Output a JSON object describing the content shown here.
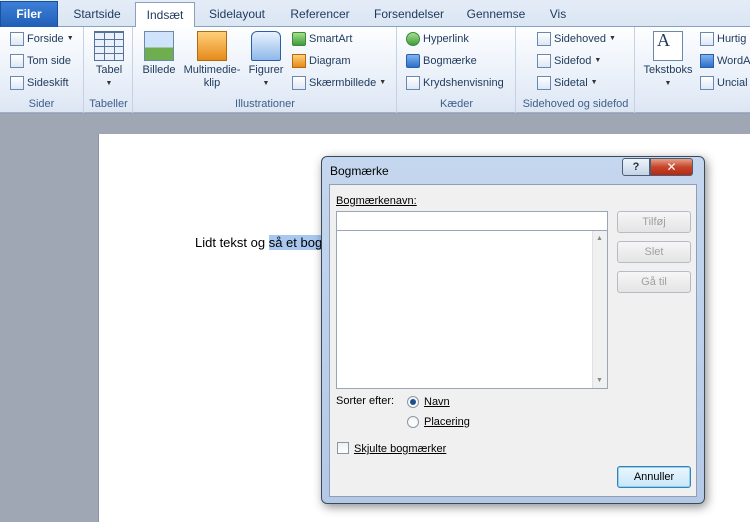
{
  "tabs": [
    {
      "label": "Filer"
    },
    {
      "label": "Startside"
    },
    {
      "label": "Indsæt"
    },
    {
      "label": "Sidelayout"
    },
    {
      "label": "Referencer"
    },
    {
      "label": "Forsendelser"
    },
    {
      "label": "Gennemse"
    },
    {
      "label": "Vis"
    }
  ],
  "ribbon": {
    "sider": {
      "label": "Sider",
      "items": [
        "Forside",
        "Tom side",
        "Sideskift"
      ]
    },
    "tabeller": {
      "label": "Tabeller",
      "tabel": "Tabel"
    },
    "illustrationer": {
      "label": "Illustrationer",
      "billede": "Billede",
      "multimedie_line1": "Multimedie-",
      "multimedie_line2": "klip",
      "figurer": "Figurer",
      "smartart": "SmartArt",
      "diagram": "Diagram",
      "skaermbillede": "Skærmbillede"
    },
    "kaeder": {
      "label": "Kæder",
      "hyperlink": "Hyperlink",
      "bogmaerke": "Bogmærke",
      "krydshenvisning": "Krydshenvisning"
    },
    "sidehoved": {
      "label": "Sidehoved og sidefod",
      "sidehoved": "Sidehoved",
      "sidefod": "Sidefod",
      "sidetal": "Sidetal"
    },
    "tekst": {
      "tekstboks": "Tekstboks",
      "hurtig": "Hurtig",
      "wordart": "WordA",
      "uncial": "Uncial"
    }
  },
  "document": {
    "text_plain": "Lidt tekst og ",
    "text_selected": "så et bog"
  },
  "dialog": {
    "title": "Bogmærke",
    "help": "?",
    "close": "✕",
    "name_label": "Bogmærkenavn:",
    "name_value": "",
    "buttons": {
      "add": "Tilføj",
      "delete": "Slet",
      "goto": "Gå til",
      "cancel": "Annuller"
    },
    "sort_label": "Sorter efter:",
    "sort_options": [
      "Navn",
      "Placering"
    ],
    "sort_selected": "Navn",
    "hidden_label": "Skjulte bogmærker"
  }
}
